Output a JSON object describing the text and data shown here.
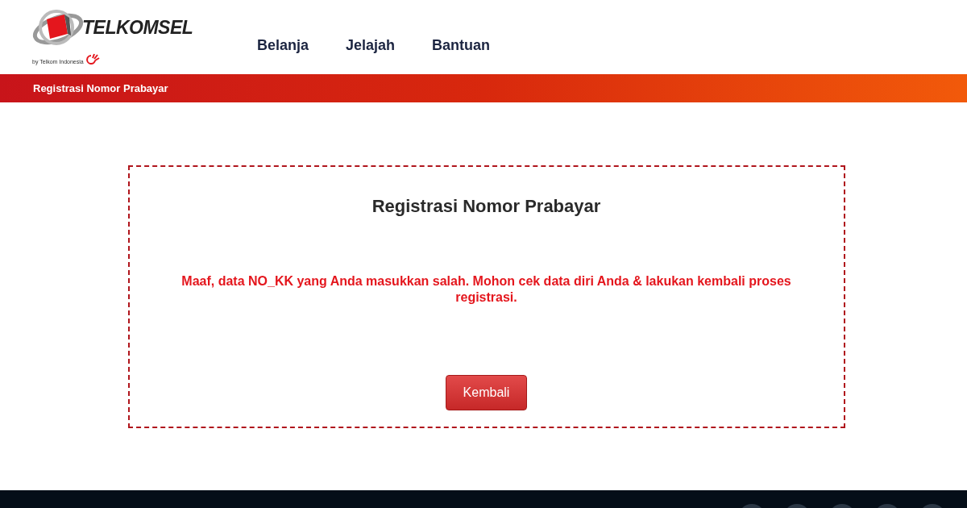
{
  "logo": {
    "name": "TELKOMSEL",
    "tagline": "by Telkom Indonesia"
  },
  "nav": [
    {
      "label": "Belanja"
    },
    {
      "label": "Jelajah"
    },
    {
      "label": "Bantuan"
    }
  ],
  "breadcrumb": "Registrasi Nomor Prabayar",
  "panel": {
    "title": "Registrasi Nomor Prabayar",
    "error": "Maaf, data NO_KK yang Anda masukkan salah. Mohon cek data diri Anda & lakukan kembali proses registrasi.",
    "button": "Kembali"
  }
}
